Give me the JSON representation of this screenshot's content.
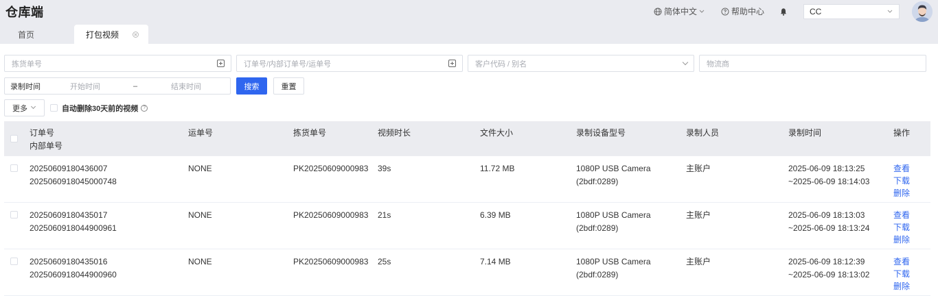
{
  "app": {
    "title": "仓库端"
  },
  "header": {
    "language": "简体中文",
    "help": "帮助中心",
    "user": "CC"
  },
  "tabs": [
    {
      "label": "首页",
      "active": false
    },
    {
      "label": "打包视频",
      "active": true
    }
  ],
  "filters": {
    "pick_no_placeholder": "拣货单号",
    "order_no_placeholder": "订单号/内部订单号/运单号",
    "customer_placeholder": "客户代码 / 别名",
    "carrier_placeholder": "物流商",
    "record_time_label": "录制时间",
    "start_placeholder": "开始时间",
    "range_separator": "–",
    "end_placeholder": "结束时间",
    "search_label": "搜索",
    "reset_label": "重置",
    "more_label": "更多",
    "auto_delete_label": "自动删除30天前的视频"
  },
  "table": {
    "columns": {
      "order_no": "订单号",
      "inner_no": "内部单号",
      "tracking_no": "运单号",
      "pick_no": "拣货单号",
      "duration": "视频时长",
      "file_size": "文件大小",
      "device": "录制设备型号",
      "recorder": "录制人员",
      "record_time": "录制时间",
      "actions": "操作"
    },
    "rows": [
      {
        "order_no": "20250609180436007",
        "inner_no": "2025060918045000748",
        "tracking_no": "NONE",
        "pick_no": "PK20250609000983",
        "duration": "39s",
        "file_size": "11.72 MB",
        "device": "1080P USB Camera (2bdf:0289)",
        "recorder": "主账户",
        "time_start": "2025-06-09 18:13:25",
        "time_end": "~2025-06-09 18:14:03",
        "view": "查看",
        "download": "下载",
        "delete": "删除"
      },
      {
        "order_no": "20250609180435017",
        "inner_no": "2025060918044900961",
        "tracking_no": "NONE",
        "pick_no": "PK20250609000983",
        "duration": "21s",
        "file_size": "6.39 MB",
        "device": "1080P USB Camera (2bdf:0289)",
        "recorder": "主账户",
        "time_start": "2025-06-09 18:13:03",
        "time_end": "~2025-06-09 18:13:24",
        "view": "查看",
        "download": "下载",
        "delete": "删除"
      },
      {
        "order_no": "20250609180435016",
        "inner_no": "2025060918044900960",
        "tracking_no": "NONE",
        "pick_no": "PK20250609000983",
        "duration": "25s",
        "file_size": "7.14 MB",
        "device": "1080P USB Camera (2bdf:0289)",
        "recorder": "主账户",
        "time_start": "2025-06-09 18:12:39",
        "time_end": "~2025-06-09 18:13:02",
        "view": "查看",
        "download": "下载",
        "delete": "删除"
      }
    ]
  },
  "colors": {
    "primary": "#2f66ef",
    "header_bg": "#eaebf0",
    "table_head_bg": "#ebecf0",
    "border": "#dcdfe6"
  }
}
